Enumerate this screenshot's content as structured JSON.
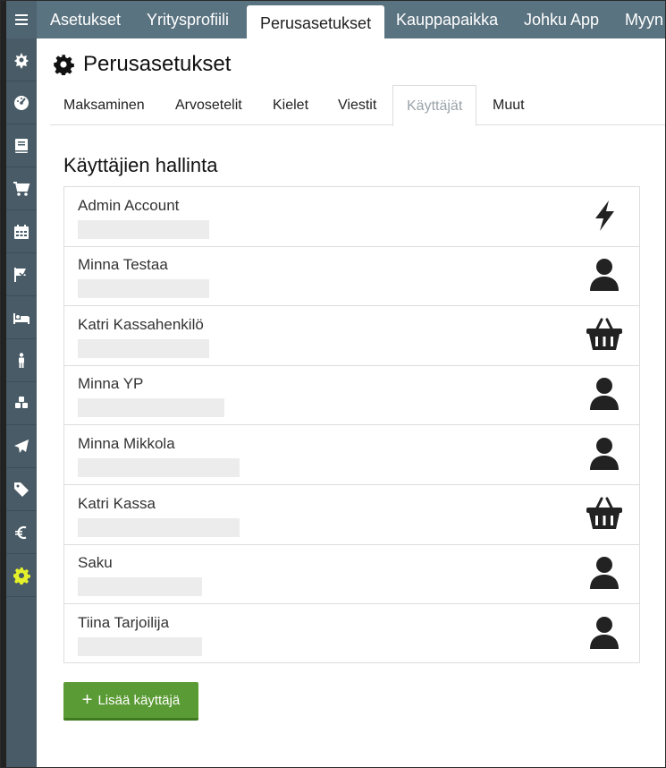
{
  "top_tabs": [
    {
      "label": "Asetukset"
    },
    {
      "label": "Yritysprofiili"
    },
    {
      "label": "Perusasetukset"
    },
    {
      "label": "Kauppapaikka"
    },
    {
      "label": "Johku App"
    },
    {
      "label": "Myyn"
    }
  ],
  "sidebar": {
    "items": [
      {
        "icon": "settings-star-icon"
      },
      {
        "icon": "dashboard-icon"
      },
      {
        "icon": "book-icon"
      },
      {
        "icon": "cart-icon"
      },
      {
        "icon": "calendar-icon"
      },
      {
        "icon": "flag-icon"
      },
      {
        "icon": "bed-icon"
      },
      {
        "icon": "person-icon"
      },
      {
        "icon": "cubes-icon"
      },
      {
        "icon": "paper-plane-icon"
      },
      {
        "icon": "tag-icon"
      },
      {
        "icon": "euro-icon"
      },
      {
        "icon": "gear-icon",
        "active": true
      }
    ],
    "active_color": "#e4f02a"
  },
  "page": {
    "title": "Perusasetukset",
    "subtabs": [
      {
        "label": "Maksaminen"
      },
      {
        "label": "Arvosetelit"
      },
      {
        "label": "Kielet"
      },
      {
        "label": "Viestit"
      },
      {
        "label": "Käyttäjät"
      },
      {
        "label": "Muut"
      }
    ],
    "section_title": "Käyttäjien hallinta",
    "users": [
      {
        "name": "Admin Account",
        "icon": "bolt-icon"
      },
      {
        "name": "Minna Testaa",
        "icon": "user-icon"
      },
      {
        "name": "Katri Kassahenkilö",
        "icon": "basket-icon"
      },
      {
        "name": "Minna YP",
        "icon": "user-icon"
      },
      {
        "name": "Minna Mikkola",
        "icon": "user-icon"
      },
      {
        "name": "Katri Kassa",
        "icon": "basket-icon"
      },
      {
        "name": "Saku",
        "icon": "user-icon"
      },
      {
        "name": "Tiina Tarjoilija",
        "icon": "user-icon"
      }
    ],
    "add_button": {
      "plus": "+",
      "label": "Lisää käyttäjä"
    }
  },
  "colors": {
    "sidebar": "#485b66",
    "topbar": "#5a7380",
    "button": "#5b9b35"
  }
}
